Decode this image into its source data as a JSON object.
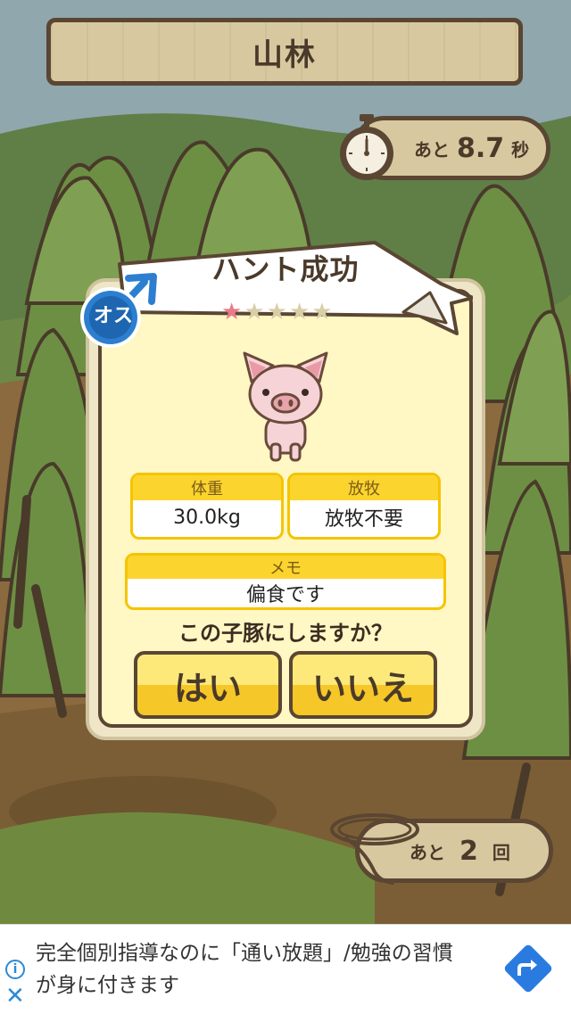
{
  "location": {
    "title": "山林"
  },
  "timer": {
    "prefix": "あと",
    "value": "8.7",
    "unit": "秒"
  },
  "count": {
    "prefix": "あと",
    "value": "2",
    "unit": "回"
  },
  "dialog": {
    "title": "ハント成功",
    "rating": {
      "value": 1,
      "max": 5
    },
    "gender_badge": "オス",
    "stats": {
      "weight": {
        "label": "体重",
        "value": "30.0kg"
      },
      "grazing": {
        "label": "放牧",
        "value": "放牧不要"
      },
      "memo": {
        "label": "メモ",
        "value": "偏食です"
      }
    },
    "question": "この子豚にしますか？",
    "yes_label": "はい",
    "no_label": "いいえ"
  },
  "ad": {
    "text": "完全個別指導なのに「通い放題」/勉強の習慣が身に付きます",
    "info_icon": "info-icon",
    "close_icon": "close-icon",
    "action_icon": "directions-arrow-icon"
  },
  "colors": {
    "wood_border": "#5a4632",
    "plank": "#d8c8a0",
    "card": "#fff7c4",
    "button_top": "#fde97a",
    "button_bottom": "#f6c728",
    "stat_header": "#fcd42e",
    "star_on": "#e87a8a",
    "male_blue": "#2c7fd0"
  }
}
